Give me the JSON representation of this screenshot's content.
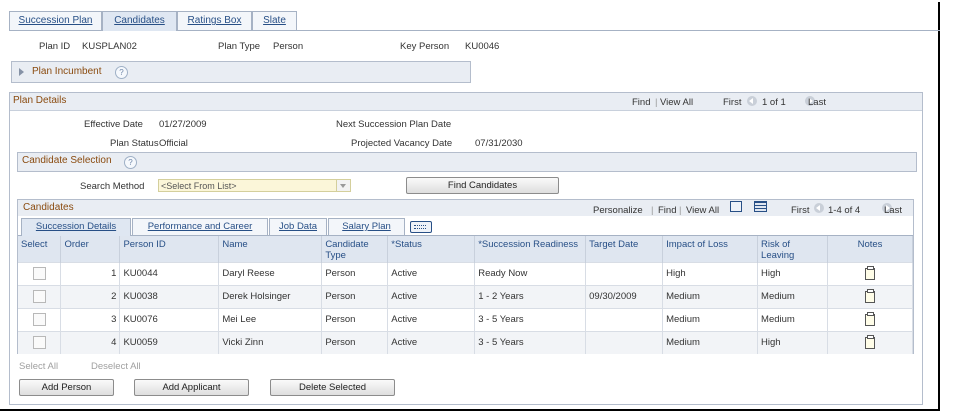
{
  "tabs": [
    "Succession Plan",
    "Candidates",
    "Ratings Box",
    "Slate"
  ],
  "header": {
    "plan_id_label": "Plan ID",
    "plan_id": "KUSPLAN02",
    "plan_type_label": "Plan Type",
    "plan_type": "Person",
    "key_person_label": "Key Person",
    "key_person": "KU0046"
  },
  "plan_incumbent": "Plan Incumbent",
  "plan_details": {
    "title": "Plan Details",
    "nav_find": "Find",
    "nav_view_all": "View All",
    "nav_first": "First",
    "nav_range": "1 of 1",
    "nav_last": "Last",
    "effective_date_label": "Effective Date",
    "effective_date": "01/27/2009",
    "next_plan_date_label": "Next Succession Plan Date",
    "plan_status_label": "Plan Status",
    "plan_status": "Official",
    "projected_vacancy_label": "Projected Vacancy Date",
    "projected_vacancy": "07/31/2030"
  },
  "candidate_selection": {
    "title": "Candidate Selection",
    "search_method_label": "Search Method",
    "search_method_value": "<Select From List>",
    "find_button": "Find Candidates"
  },
  "candidates": {
    "title": "Candidates",
    "personalize": "Personalize",
    "find": "Find",
    "view_all": "View All",
    "first": "First",
    "range": "1-4 of 4",
    "last": "Last",
    "tabs": [
      "Succession Details",
      "Performance and Career",
      "Job Data",
      "Salary Plan"
    ],
    "columns": [
      "Select",
      "Order",
      "Person ID",
      "Name",
      "Candidate Type",
      "*Status",
      "*Succession Readiness",
      "Target Date",
      "Impact of Loss",
      "Risk of Leaving",
      "Notes"
    ],
    "rows": [
      {
        "order": "1",
        "person_id": "KU0044",
        "name": "Daryl Reese",
        "type": "Person",
        "status": "Active",
        "readiness": "Ready Now",
        "target_date": "",
        "impact": "High",
        "risk": "High"
      },
      {
        "order": "2",
        "person_id": "KU0038",
        "name": "Derek Holsinger",
        "type": "Person",
        "status": "Active",
        "readiness": "1 - 2 Years",
        "target_date": "09/30/2009",
        "impact": "Medium",
        "risk": "Medium"
      },
      {
        "order": "3",
        "person_id": "KU0076",
        "name": "Mei Lee",
        "type": "Person",
        "status": "Active",
        "readiness": "3 - 5 Years",
        "target_date": "",
        "impact": "Medium",
        "risk": "Medium"
      },
      {
        "order": "4",
        "person_id": "KU0059",
        "name": "Vicki Zinn",
        "type": "Person",
        "status": "Active",
        "readiness": "3 - 5 Years",
        "target_date": "",
        "impact": "Medium",
        "risk": "High"
      }
    ]
  },
  "select_all": "Select All",
  "deselect_all": "Deselect All",
  "buttons": {
    "add_person": "Add Person",
    "add_applicant": "Add Applicant",
    "delete_selected": "Delete Selected"
  }
}
